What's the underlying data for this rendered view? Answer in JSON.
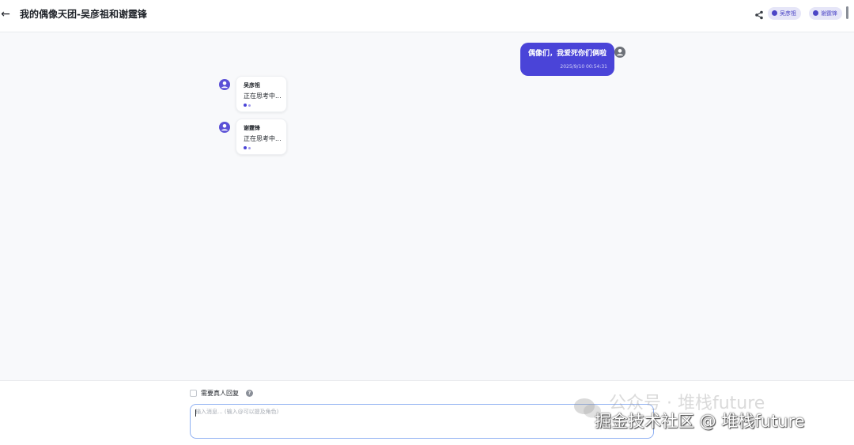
{
  "header": {
    "back_icon": "arrow-left-icon",
    "title": "我的偶像天团-吴彦祖和谢霆锋",
    "share_icon": "share-icon",
    "participants": [
      {
        "label": "吴彦祖",
        "icon": "person-icon"
      },
      {
        "label": "谢霆锋",
        "icon": "person-icon"
      }
    ]
  },
  "colors": {
    "accent": "#4a44d8",
    "chip_bg": "#e6e6f8",
    "input_border": "#8fb0f2"
  },
  "messages": [
    {
      "role": "user",
      "text": "偶像们，我爱死你们俩啦",
      "time": "2025/9/10 00:54:31",
      "avatar": "user-avatar-icon"
    },
    {
      "role": "ai",
      "name": "吴彦祖",
      "status": "正在思考中...",
      "avatar": "person-avatar-icon"
    },
    {
      "role": "ai",
      "name": "谢霆锋",
      "status": "正在思考中...",
      "avatar": "person-avatar-icon"
    }
  ],
  "composer": {
    "checkbox_label": "需要真人回复",
    "checkbox_checked": false,
    "help_icon": "question-circle-icon",
    "placeholder": "输入消息... (输入@可以提及角色)",
    "value": ""
  },
  "watermark": {
    "top_text": "公众号 · 堆栈future",
    "bottom_text": "掘金技术社区 @ 堆栈future"
  }
}
